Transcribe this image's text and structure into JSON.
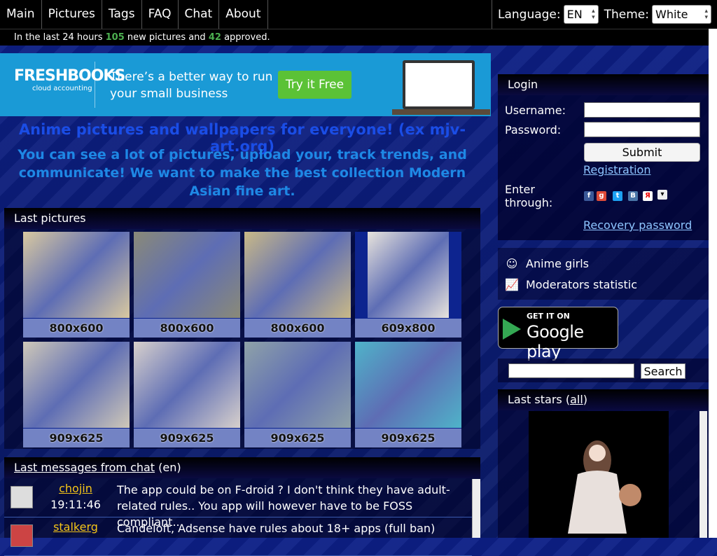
{
  "nav": [
    "Main",
    "Pictures",
    "Tags",
    "FAQ",
    "Chat",
    "About"
  ],
  "language": {
    "label": "Language:",
    "value": "EN"
  },
  "theme": {
    "label": "Theme:",
    "value": "White"
  },
  "stats": {
    "pre": "In the last 24 hours",
    "new_count": "105",
    "mid": "new pictures and",
    "approved_count": "42",
    "post": "approved."
  },
  "ad": {
    "brand": "FRESHBOOKS",
    "brand_sub": "cloud accounting",
    "tagline1": "There’s a better way to run",
    "tagline2": "your small business",
    "cta": "Try it Free"
  },
  "headline": "Anime pictures and wallpapers for everyone! (ex mjv-art.org)",
  "subheadline": "You can see a lot of pictures, upload your, track trends, and communicate! We want to make the best collection Modern Asian fine art.",
  "last_pictures": {
    "title": "Last pictures",
    "items": [
      {
        "size": "800x600",
        "color": "#d9c9a0"
      },
      {
        "size": "800x600",
        "color": "#8a8a78"
      },
      {
        "size": "800x600",
        "color": "#c9b987"
      },
      {
        "size": "609x800",
        "color": "#e8e4dc"
      },
      {
        "size": "909x625",
        "color": "#cfc8b8"
      },
      {
        "size": "909x625",
        "color": "#d7d0cc"
      },
      {
        "size": "909x625",
        "color": "#8fa2a8"
      },
      {
        "size": "909x625",
        "color": "#4fb3c9"
      }
    ]
  },
  "chat": {
    "title": "Last messages from chat",
    "lang": "(en)",
    "messages": [
      {
        "user": "chojin",
        "time": "19:11:46",
        "text": "The app could be on F-droid ? I don't think they have adult-related rules.. You app will however have to be FOSS compliant.."
      },
      {
        "user": "stalkerg",
        "time": "",
        "text": "Candeloft, Adsense have rules about 18+ apps (full ban)"
      }
    ]
  },
  "login": {
    "title": "Login",
    "username_label": "Username:",
    "password_label": "Password:",
    "submit": "Submit",
    "registration": "Registration",
    "enter_line1": "Enter",
    "enter_line2": "through:",
    "recovery": "Recovery password"
  },
  "menu": [
    {
      "label": "Anime girls",
      "icon": "girl-icon"
    },
    {
      "label": "Moderators statistic",
      "icon": "chart-icon"
    }
  ],
  "gplay": {
    "line1": "GET IT ON",
    "line2": "Google play"
  },
  "search": {
    "button": "Search"
  },
  "stars": {
    "title": "Last stars (",
    "link": "all",
    "close": ")"
  }
}
